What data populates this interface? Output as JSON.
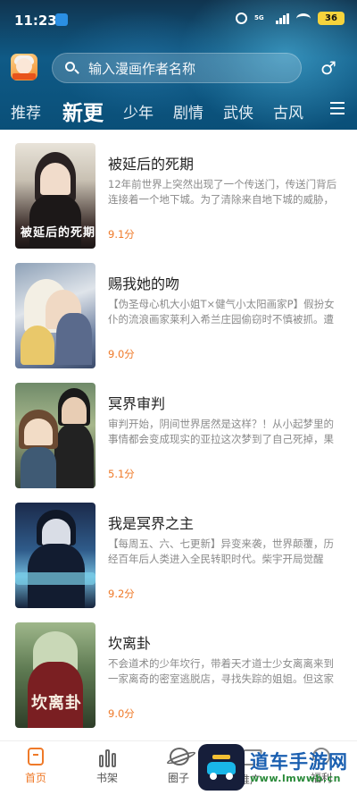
{
  "status_bar": {
    "time": "11:23",
    "network": "5G",
    "battery": "36"
  },
  "header": {
    "search_placeholder": "输入漫画作者名称",
    "gender_symbol": "♂",
    "tabs": [
      "推荐",
      "新更",
      "少年",
      "剧情",
      "武侠",
      "古风"
    ],
    "active_tab": "新更"
  },
  "comics": [
    {
      "title": "被延后的死期",
      "desc": "12年前世界上突然出现了一个传送门，传送门背后连接着一个地下城。为了清除来自地下城的威胁，12年…",
      "score": "9.1分",
      "cover_text": "被延后的死期"
    },
    {
      "title": "赐我她的吻",
      "desc": "【伪圣母心机大小姐T×健气小太阳画家P】假扮女仆的流浪画家莱利入希兰庄园偷窃时不慎被抓。遭受待…",
      "score": "9.0分",
      "cover_text": ""
    },
    {
      "title": "冥界审判",
      "desc": "审判开始，阴间世界居然是这样？！从小起梦里的事情都会变成现实的亚拉这次梦到了自己死掉，果然，…",
      "score": "5.1分",
      "cover_text": ""
    },
    {
      "title": "我是冥界之主",
      "desc": "【每周五、六、七更新】异变来袭，世界颠覆，历经百年后人类进入全民转职时代。柴宇开局觉醒SSS级…",
      "score": "9.2分",
      "cover_text": ""
    },
    {
      "title": "坎离卦",
      "desc": "不会道术的少年坎行，带着天才道士少女离离来到一家离奇的密室逃脱店，寻找失踪的姐姐。但这家店…",
      "score": "9.0分",
      "cover_text": "坎离卦"
    }
  ],
  "bottom_nav": {
    "items": [
      "首页",
      "书架",
      "圈子",
      "推广",
      "福利"
    ],
    "active": "首页"
  },
  "watermark": {
    "name": "道车手游网",
    "url": "www.lmwwb.cn"
  },
  "colors": {
    "accent": "#ef7a29",
    "header_top": "#10344f",
    "header_bottom": "#0a4f78"
  }
}
